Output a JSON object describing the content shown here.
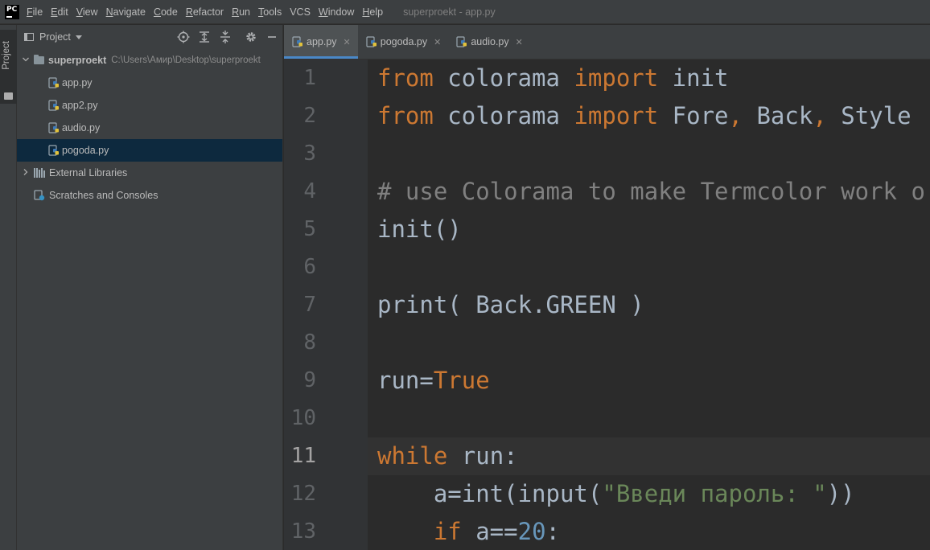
{
  "app": {
    "logo_text": "PC",
    "window_title": "superproekt - app.py"
  },
  "menu": [
    {
      "u": "F",
      "rest": "ile"
    },
    {
      "u": "E",
      "rest": "dit"
    },
    {
      "u": "V",
      "rest": "iew"
    },
    {
      "u": "N",
      "rest": "avigate"
    },
    {
      "u": "C",
      "rest": "ode"
    },
    {
      "u": "R",
      "rest": "efactor"
    },
    {
      "u": "R",
      "rest": "un",
      "pre": ""
    },
    {
      "u": "T",
      "rest": "ools"
    },
    {
      "u": "",
      "rest": "VCS"
    },
    {
      "u": "W",
      "rest": "indow"
    },
    {
      "u": "H",
      "rest": "elp"
    }
  ],
  "tool_strip": {
    "project_label": "Project"
  },
  "project_panel": {
    "title": "Project",
    "root": {
      "name": "superproekt",
      "path": "C:\\Users\\Амир\\Desktop\\superproekt"
    },
    "files": [
      "app.py",
      "app2.py",
      "audio.py",
      "pogoda.py"
    ],
    "selected_file": "pogoda.py",
    "external_libraries": "External Libraries",
    "scratches": "Scratches and Consoles"
  },
  "tabs": [
    {
      "label": "app.py",
      "active": true
    },
    {
      "label": "pogoda.py",
      "active": false
    },
    {
      "label": "audio.py",
      "active": false
    }
  ],
  "editor": {
    "current_line": 11,
    "lines": [
      {
        "n": "1",
        "tokens": [
          [
            "kw",
            "from"
          ],
          [
            "",
            " colorama "
          ],
          [
            "kw",
            "import"
          ],
          [
            "",
            " init"
          ]
        ]
      },
      {
        "n": "2",
        "tokens": [
          [
            "kw",
            "from"
          ],
          [
            "",
            " colorama "
          ],
          [
            "kw",
            "import"
          ],
          [
            "",
            " Fore"
          ],
          [
            "kw",
            ","
          ],
          [
            "",
            " Back"
          ],
          [
            "kw",
            ","
          ],
          [
            "",
            " Style"
          ]
        ]
      },
      {
        "n": "3",
        "tokens": []
      },
      {
        "n": "4",
        "tokens": [
          [
            "cm",
            "# use Colorama to make Termcolor work o"
          ]
        ]
      },
      {
        "n": "5",
        "tokens": [
          [
            "",
            "init()"
          ]
        ]
      },
      {
        "n": "6",
        "tokens": []
      },
      {
        "n": "7",
        "tokens": [
          [
            "",
            "print( Back.GREEN )"
          ]
        ]
      },
      {
        "n": "8",
        "tokens": []
      },
      {
        "n": "9",
        "tokens": [
          [
            "",
            "run="
          ],
          [
            "kw",
            "True"
          ]
        ]
      },
      {
        "n": "10",
        "tokens": []
      },
      {
        "n": "11",
        "tokens": [
          [
            "kw",
            "while"
          ],
          [
            "",
            " run:"
          ]
        ]
      },
      {
        "n": "12",
        "tokens": [
          [
            "",
            "    a=int(input("
          ],
          [
            "str",
            "\"Введи пароль: \""
          ],
          [
            "",
            "))"
          ]
        ]
      },
      {
        "n": "13",
        "tokens": [
          [
            "",
            "    "
          ],
          [
            "kw",
            "if"
          ],
          [
            "",
            " a=="
          ],
          [
            "num",
            "20"
          ],
          [
            "",
            ":"
          ]
        ]
      }
    ]
  }
}
